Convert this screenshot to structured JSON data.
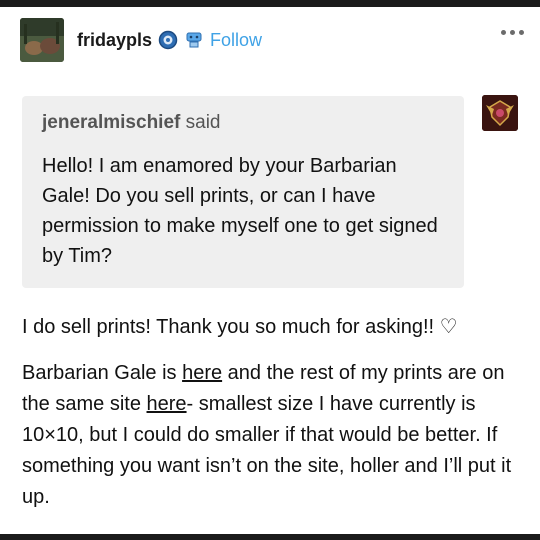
{
  "post": {
    "username": "fridaypls",
    "follow_label": "Follow"
  },
  "ask": {
    "asker": "jeneralmischief",
    "said": "said",
    "question": "Hello! I am enamored by your Barbarian Gale! Do you sell prints, or can I have permission to make myself one to get signed by Tim?"
  },
  "answer": {
    "paragraph1": "I do sell prints! Thank you so much for asking!! ♡",
    "p2_part1": "Barbarian Gale is ",
    "p2_link1": "here",
    "p2_part2": " and the rest of my prints are on the same site ",
    "p2_link2": "here",
    "p2_part3": "- smallest size I have currently is 10×10, but I could do smaller if that would be better. If something you want isn’t on the site, holler and I’ll put it up."
  },
  "colors": {
    "follow": "#3fa2e6",
    "ask_background": "#efefef",
    "bars": "#1b1b1b"
  },
  "icons": [
    "avatar-image",
    "blue-badge-icon",
    "gear-robot-icon",
    "more-dots-icon",
    "asker-avatar-emblem"
  ]
}
